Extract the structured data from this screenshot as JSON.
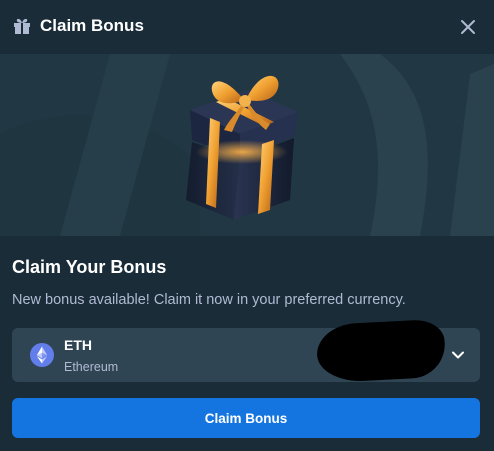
{
  "modal": {
    "title": "Claim Bonus",
    "header_icon": "gift-icon",
    "close_icon": "close-icon"
  },
  "banner": {
    "image": "gift-box-illustration"
  },
  "content": {
    "heading": "Claim Your Bonus",
    "subtitle": "New bonus available! Claim it now in your preferred currency."
  },
  "currency": {
    "code": "ETH",
    "name": "Ethereum",
    "icon": "ethereum-icon",
    "dropdown_icon": "chevron-down-icon"
  },
  "actions": {
    "claim_label": "Claim Bonus"
  },
  "colors": {
    "background": "#1a2c38",
    "banner": "#213743",
    "select": "#2f4553",
    "accent": "#1475e1",
    "muted_text": "#b1bad3",
    "eth": "#627eea"
  }
}
